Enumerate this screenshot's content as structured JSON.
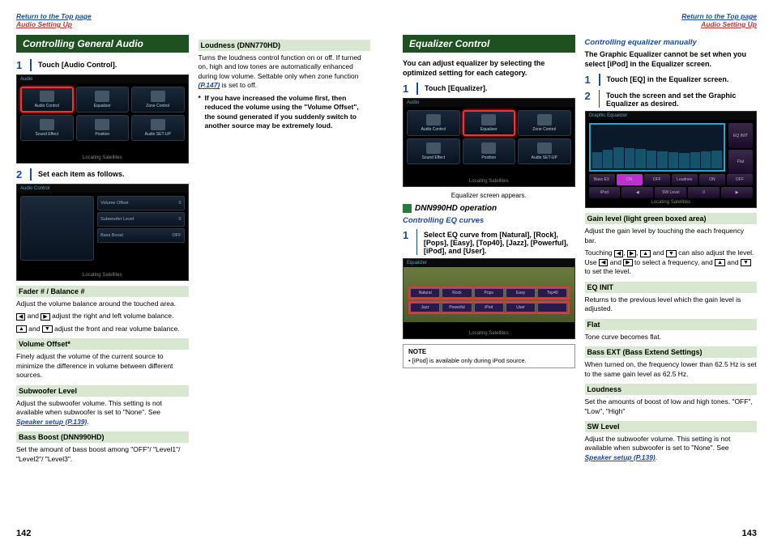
{
  "header": {
    "top": "Return to the Top page",
    "sub": "Audio Setting Up"
  },
  "left": {
    "title": "Controlling General Audio",
    "step1": "Touch [Audio Control].",
    "step2": "Set each item as follows.",
    "screen": {
      "top": "Audio",
      "cells": [
        "Audio Control",
        "Equalizer",
        "Zone Control",
        "Sound Effect",
        "Position",
        "Audio SET-UP"
      ],
      "bottom": "Locating Satellites"
    },
    "ctrlRows": [
      "Volume Offset",
      "Subwoofer Level",
      "Bass Boost"
    ],
    "items": [
      {
        "h": "Fader # / Balance #",
        "t": "Adjust the volume balance around the touched area.",
        "t2": "[◀] and [▶] adjust the right and left volume balance.",
        "t3": "[▲] and [▼] adjust the front and rear volume balance."
      },
      {
        "h": "Volume Offset*",
        "t": "Finely adjust the volume of the current source to minimize the difference in volume between different sources."
      },
      {
        "h": "Subwoofer Level",
        "t": "Adjust the subwoofer volume. This setting is not available when subwoofer is set to \"None\". See ",
        "link": "Speaker setup (P.139)"
      },
      {
        "h": "Bass Boost (DNN990HD)",
        "t": "Set the amount of bass boost among \"OFF\"/ \"Level1\"/ \"Level2\"/ \"Level3\"."
      }
    ],
    "col2": {
      "loudH": "Loudness (DNN770HD)",
      "loudT": "Turns the loudness control function on or off. If turned on, high and low tones are automatically enhanced during low volume. Settable only when zone function ",
      "loudLink": "(P.147)",
      "loudT2": " is set to off.",
      "warn": "If you have increased the volume first, then reduced the volume using the \"Volume Offset\", the sound generated if you suddenly switch to another source may be extremely loud."
    },
    "page": "142"
  },
  "right": {
    "title": "Equalizer Control",
    "intro": "You can adjust equalizer by selecting the optimized setting for each category.",
    "step1": "Touch [Equalizer].",
    "caption": "Equalizer screen appears.",
    "sub": "DNN990HD operation",
    "subsub": "Controlling EQ curves",
    "eqStep": "Select EQ curve from [Natural], [Rock], [Pops], [Easy], [Top40], [Jazz], [Powerful], [iPod], and [User].",
    "eqTabs1": [
      "Natural",
      "Rock",
      "Pops",
      "Easy",
      "Top40"
    ],
    "eqTabs2": [
      "Jazz",
      "Powerful",
      "iPod",
      "User",
      ""
    ],
    "note": "[iPod] is available only during iPod source.",
    "col2": {
      "sub": "Controlling equalizer manually",
      "intro": "The Graphic Equalizer cannot be set when you select [iPod] in the Equalizer screen.",
      "step1": "Touch [EQ] in the Equalizer screen.",
      "step2": "Touch the screen and set the Graphic Equalizer as desired.",
      "geqTop": "Graphic Equalizer",
      "geqBtns": [
        "Bass EX",
        "ON",
        "OFF",
        "Loudnes",
        "ON",
        "OFF"
      ],
      "geqSide": [
        "EQ INIT",
        "Flat"
      ],
      "items": [
        {
          "h": "Gain level (light green boxed area)",
          "t": "Adjust the gain level by touching the each frequency bar.",
          "t2": "Touching [◀], [▶], [▲] and [▼] can also adjust the level. Use [◀] and [▶] to select a frequency, and [▲] and [▼] to set the level."
        },
        {
          "h": "EQ INIT",
          "t": "Returns to the previous level which the gain level is adjusted."
        },
        {
          "h": "Flat",
          "t": "Tone curve becomes flat."
        },
        {
          "h": "Bass EXT (Bass Extend Settings)",
          "t": "When turned on, the frequency lower than 62.5 Hz is set to the same gain level as 62.5 Hz."
        },
        {
          "h": "Loudness",
          "t": "Set the amounts of boost of low and high tones. \"OFF\", \"Low\", \"High\""
        },
        {
          "h": "SW Level",
          "t": "Adjust the subwoofer volume. This setting is not available when subwoofer is set to \"None\". See ",
          "link": "Speaker setup (P.139)"
        }
      ]
    },
    "page": "143"
  }
}
